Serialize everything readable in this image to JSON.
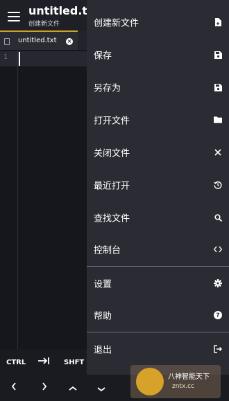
{
  "appbar": {
    "title": "untitled.txt",
    "subtitle": "创建新文件"
  },
  "tab": {
    "label": "untitled.txt"
  },
  "editor": {
    "line_number": "1"
  },
  "keybar": {
    "ctrl": "CTRL",
    "tab_symbol": "⇥",
    "shift": "SHFT",
    "left": "‹",
    "right": "›",
    "up": "ˆ",
    "down": "ˇ"
  },
  "drawer": {
    "items": [
      {
        "label": "创建新文件",
        "icon": "new-file-icon"
      },
      {
        "label": "保存",
        "icon": "save-icon"
      },
      {
        "label": "另存为",
        "icon": "save-as-icon"
      },
      {
        "label": "打开文件",
        "icon": "folder-icon"
      },
      {
        "label": "关闭文件",
        "icon": "close-icon"
      },
      {
        "label": "最近打开",
        "icon": "history-icon"
      },
      {
        "label": "查找文件",
        "icon": "search-icon"
      },
      {
        "label": "控制台",
        "icon": "code-icon"
      },
      {
        "label": "设置",
        "icon": "gear-icon"
      },
      {
        "label": "帮助",
        "icon": "help-icon"
      },
      {
        "label": "退出",
        "icon": "exit-icon"
      }
    ]
  },
  "watermark": {
    "text": "八神智能天下",
    "url": "zntx.cc"
  },
  "colors": {
    "accent": "#c9a227",
    "drawer_bg": "#2b2c33",
    "editor_bg": "#16171d"
  }
}
